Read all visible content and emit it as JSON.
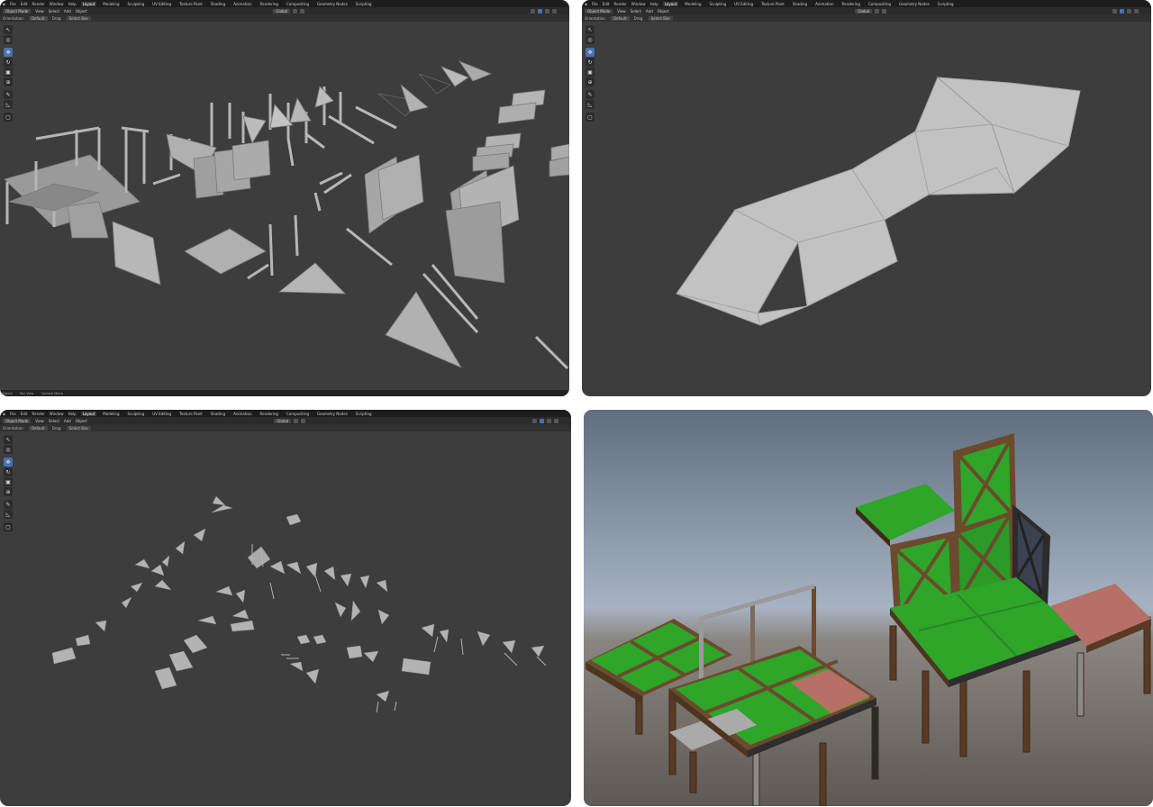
{
  "menu": [
    "File",
    "Edit",
    "Render",
    "Window",
    "Help"
  ],
  "workspaces_top": [
    "Layout",
    "Modeling",
    "Sculpting",
    "UV Editing",
    "Texture Paint",
    "Shading",
    "Animation",
    "Rendering",
    "Compositing",
    "Geometry Nodes",
    "Scripting"
  ],
  "workspaces_bottom": [
    "Layout",
    "Modeling",
    "Sculpting",
    "UV Editing",
    "Texture Paint",
    "Shading",
    "Animation",
    "Rendering",
    "Compositing",
    "Geometry Nodes",
    "Scripting"
  ],
  "header": {
    "mode": "Object Mode",
    "view": "View",
    "select": "Select",
    "add": "Add",
    "object": "Object",
    "transform": "Global"
  },
  "header2": {
    "orientation": "Orientation:",
    "default": "Default",
    "drag": "Drag:",
    "select_box": "Select Box"
  },
  "tools": [
    "select-tool",
    "cursor-tool",
    "move-tool",
    "rotate-tool",
    "scale-tool",
    "transform-tool",
    "annotate-tool",
    "measure-tool",
    "add-cube-tool"
  ],
  "status": [
    "Select",
    "Pan View",
    "Context Menu"
  ]
}
